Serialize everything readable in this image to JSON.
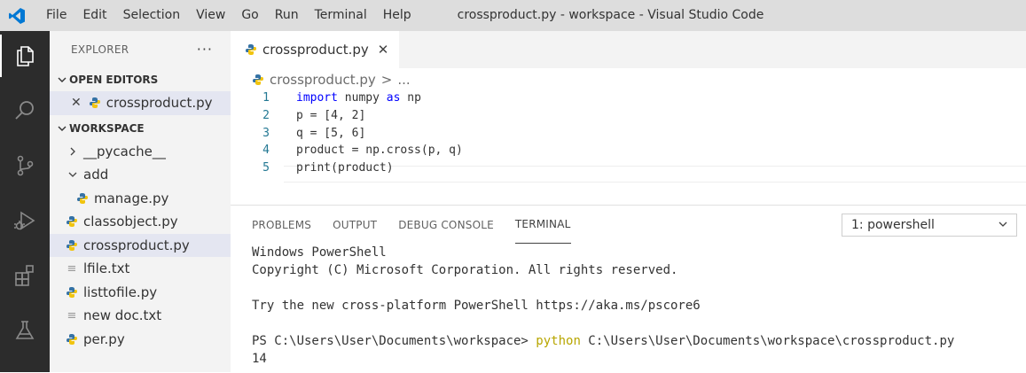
{
  "menu": [
    "File",
    "Edit",
    "Selection",
    "View",
    "Go",
    "Run",
    "Terminal",
    "Help"
  ],
  "window_title": "crossproduct.py - workspace - Visual Studio Code",
  "explorer": {
    "title": "EXPLORER",
    "more": "···",
    "open_editors_label": "OPEN EDITORS",
    "open_editor_file": "crossproduct.py",
    "workspace_label": "WORKSPACE",
    "items": [
      {
        "label": "__pycache__",
        "type": "folder",
        "indent": 1,
        "expanded": false
      },
      {
        "label": "add",
        "type": "folder",
        "indent": 1,
        "expanded": true
      },
      {
        "label": "manage.py",
        "type": "py",
        "indent": 2
      },
      {
        "label": "classobject.py",
        "type": "py",
        "indent": 1
      },
      {
        "label": "crossproduct.py",
        "type": "py",
        "indent": 1,
        "selected": true
      },
      {
        "label": "lfile.txt",
        "type": "txt",
        "indent": 1
      },
      {
        "label": "listtofile.py",
        "type": "py",
        "indent": 1
      },
      {
        "label": "new doc.txt",
        "type": "txt",
        "indent": 1
      },
      {
        "label": "per.py",
        "type": "py",
        "indent": 1
      }
    ]
  },
  "editor": {
    "tab_label": "crossproduct.py",
    "tab_close": "✕",
    "breadcrumb_file": "crossproduct.py",
    "breadcrumb_sep": ">",
    "breadcrumb_more": "...",
    "lines": [
      {
        "num": "1",
        "kw": "import",
        "rest": " numpy ",
        "kw2": "as",
        "rest2": " np"
      },
      {
        "num": "2",
        "text": "p = [4, 2]"
      },
      {
        "num": "3",
        "text": "q = [5, 6]"
      },
      {
        "num": "4",
        "text": "product = np.cross(p, q)"
      },
      {
        "num": "5",
        "text": "print(product)"
      }
    ]
  },
  "panel": {
    "tabs": [
      "PROBLEMS",
      "OUTPUT",
      "DEBUG CONSOLE",
      "TERMINAL"
    ],
    "active_tab": "TERMINAL",
    "shell_select": "1: powershell",
    "terminal": {
      "line1": "Windows PowerShell",
      "line2": "Copyright (C) Microsoft Corporation. All rights reserved.",
      "line3": "Try the new cross-platform PowerShell https://aka.ms/pscore6",
      "prompt": "PS C:\\Users\\User\\Documents\\workspace> ",
      "command": "python",
      "args": " C:\\Users\\User\\Documents\\workspace\\crossproduct.py",
      "output": "14"
    }
  },
  "colors": {
    "accent": "#0078d4",
    "python_blue": "#3572a5",
    "python_yellow": "#f1c40f",
    "keyword": "#0000ff",
    "line_number": "#237893"
  }
}
